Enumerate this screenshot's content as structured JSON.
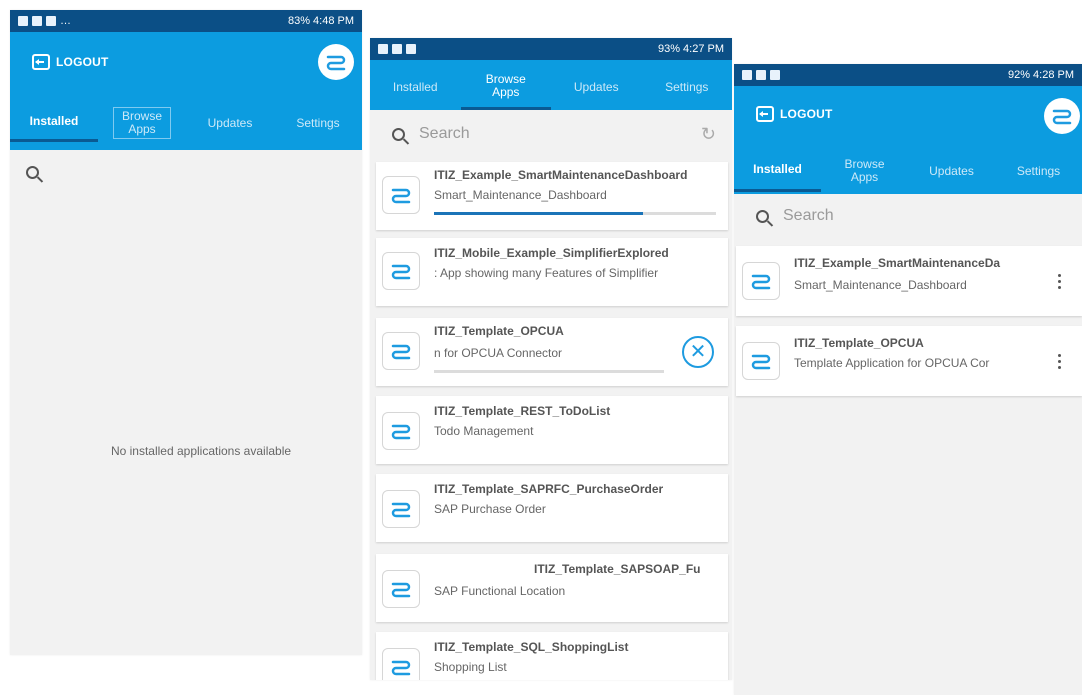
{
  "brand": {
    "primary": "#0c9ce0",
    "status_bar": "#0b4f86",
    "accent": "#1b74b8"
  },
  "icons": {
    "app": "simplifier-logo-icon",
    "logout": "logout-icon",
    "search": "search-icon",
    "refresh": "refresh-icon",
    "cancel": "cancel-download-icon",
    "more": "more-vert-icon"
  },
  "screen1": {
    "status_left": "…",
    "status_right": "83% 4:48 PM",
    "logout_label": "LOGOUT",
    "tabs": [
      "Installed",
      "Browse Apps",
      "Updates",
      "Settings"
    ],
    "active_tab": "Installed",
    "empty_message": "No installed applications available"
  },
  "screen2": {
    "status_right": "93% 4:27 PM",
    "tabs": [
      "Installed",
      "Browse Apps",
      "Updates",
      "Settings"
    ],
    "active_tab": "Browse Apps",
    "search_placeholder": "Search",
    "apps": [
      {
        "title": "ITIZ_Example_SmartMaintenanceDashboard",
        "subtitle": "Smart_Maintenance_Dashboard",
        "download_progress": 0.74
      },
      {
        "title": "ITIZ_Mobile_Example_SimplifierExplored",
        "subtitle": ": App showing many Features of Simplifier"
      },
      {
        "title": "ITIZ_Template_OPCUA",
        "subtitle": "n for OPCUA Connector",
        "download_progress": 0.0
      },
      {
        "title": "ITIZ_Template_REST_ToDoList",
        "subtitle": "Todo Management"
      },
      {
        "title": "ITIZ_Template_SAPRFC_PurchaseOrder",
        "subtitle": "SAP Purchase Order"
      },
      {
        "title": "ITIZ_Template_SAPSOAP_Fu",
        "subtitle": "SAP Functional Location"
      },
      {
        "title": "ITIZ_Template_SQL_ShoppingList",
        "subtitle": "Shopping List"
      }
    ]
  },
  "screen3": {
    "status_right": "92% 4:28 PM",
    "logout_label": "LOGOUT",
    "tabs": [
      "Installed",
      "Browse Apps",
      "Updates",
      "Settings"
    ],
    "active_tab": "Installed",
    "search_placeholder": "Search",
    "apps": [
      {
        "title": "ITIZ_Example_SmartMaintenanceDa",
        "subtitle": "Smart_Maintenance_Dashboard"
      },
      {
        "title": "ITIZ_Template_OPCUA",
        "subtitle": "Template Application for OPCUA Cor"
      }
    ]
  }
}
